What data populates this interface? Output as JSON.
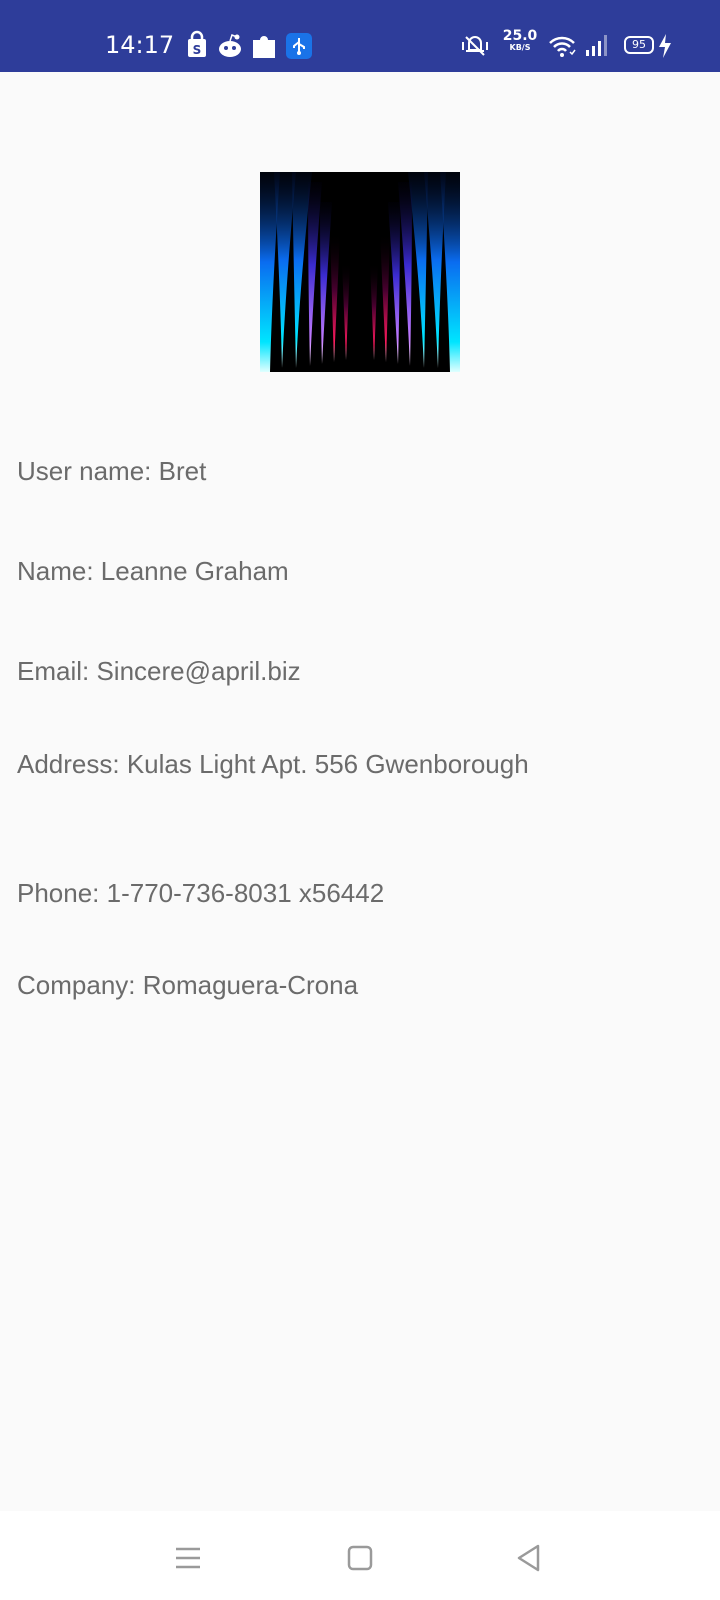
{
  "status_bar": {
    "time": "14:17",
    "notification_icons": [
      "shopping-bag-icon",
      "reddit-icon",
      "puzzle-icon",
      "usb-icon"
    ],
    "network_speed": "25.0",
    "network_speed_unit": "KB/S",
    "system_icons": [
      "vibrate-icon",
      "wifi-icon",
      "signal-icon"
    ],
    "battery_level": "95",
    "charging": true,
    "background_color": "#2e3d9a"
  },
  "profile": {
    "avatar_icon": "abstract-light-avatar",
    "username_line": "User name: Bret",
    "name_line": "Name: Leanne Graham",
    "email_line": "Email: Sincere@april.biz",
    "address_line": "Address: Kulas Light Apt. 556 Gwenborough",
    "phone_line": "Phone: 1-770-736-8031 x56442",
    "company_line": "Company: Romaguera-Crona",
    "text_color": "#6b6b6b"
  },
  "nav_bar": {
    "buttons": [
      "menu-icon",
      "home-icon",
      "back-icon"
    ]
  }
}
